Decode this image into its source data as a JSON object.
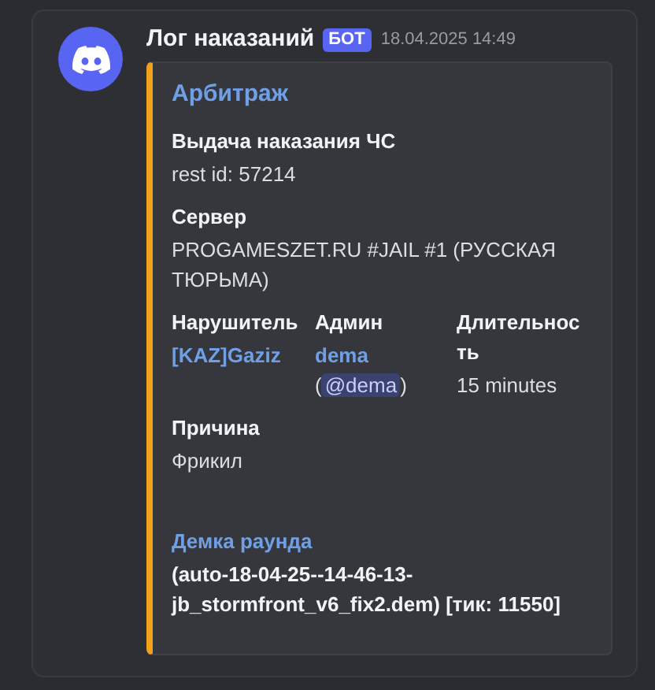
{
  "message": {
    "author": "Лог наказаний",
    "badge": "БОТ",
    "timestamp": "18.04.2025 14:49",
    "embed": {
      "title": "Арбитраж",
      "fields": [
        {
          "name": "Выдача наказания ЧС",
          "kind": "plain",
          "inline": false,
          "lines": [
            [
              {
                "kind": "text",
                "text": "rest id: 57214"
              }
            ]
          ]
        },
        {
          "name": "Сервер",
          "kind": "plain",
          "inline": false,
          "lines": [
            [
              {
                "kind": "text",
                "text": "PROGAMESZET.RU #JAIL #1 (РУССКАЯ ТЮРЬМА)"
              }
            ]
          ]
        },
        {
          "name": "Нарушитель",
          "kind": "plain",
          "inline": true,
          "lines": [
            [
              {
                "kind": "link",
                "text": "[KAZ]Gaziz"
              }
            ]
          ]
        },
        {
          "name": "Админ",
          "kind": "plain",
          "inline": true,
          "lines": [
            [
              {
                "kind": "link",
                "text": "dema"
              }
            ],
            [
              {
                "kind": "text",
                "text": "("
              },
              {
                "kind": "mention",
                "text": "@dema"
              },
              {
                "kind": "text",
                "text": ")"
              }
            ]
          ]
        },
        {
          "name": "Длительность",
          "kind": "plain",
          "inline": true,
          "lines": [
            [
              {
                "kind": "text",
                "text": "15 minutes"
              }
            ]
          ]
        },
        {
          "name": "Причина",
          "kind": "plain",
          "inline": false,
          "lines": [
            [
              {
                "kind": "text",
                "text": "Фрикил"
              }
            ]
          ]
        },
        {
          "name": "Демка раунда",
          "kind": "link",
          "inline": false,
          "lines": [
            [
              {
                "kind": "bold",
                "text": "(auto-18-04-25--14-46-13-jb_stormfront_v6_fix2.dem) [тик: 11550]"
              }
            ]
          ]
        }
      ]
    }
  }
}
